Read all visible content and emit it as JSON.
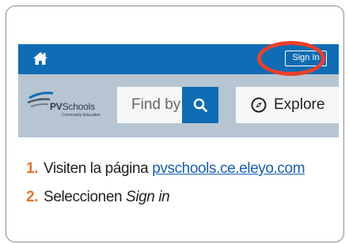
{
  "header": {
    "sign_in_label": "Sign In"
  },
  "brand": {
    "name_bold": "PV",
    "name_rest": "Schools",
    "subtitle": "Community Education"
  },
  "search": {
    "placeholder": "Find by"
  },
  "explore": {
    "label": "Explore"
  },
  "steps": [
    {
      "number": "1.",
      "text": "Visiten la página ",
      "link": "pvschools.ce.eleyo.com"
    },
    {
      "number": "2.",
      "text": "Seleccionen ",
      "emphasis": "Sign in"
    }
  ],
  "colors": {
    "brand_blue": "#0f6cb4",
    "callout_red": "#e8412c",
    "step_number_orange": "#e8712c",
    "link_blue": "#1a5fb4"
  },
  "icons": [
    "home-icon",
    "search-icon",
    "compass-icon"
  ]
}
